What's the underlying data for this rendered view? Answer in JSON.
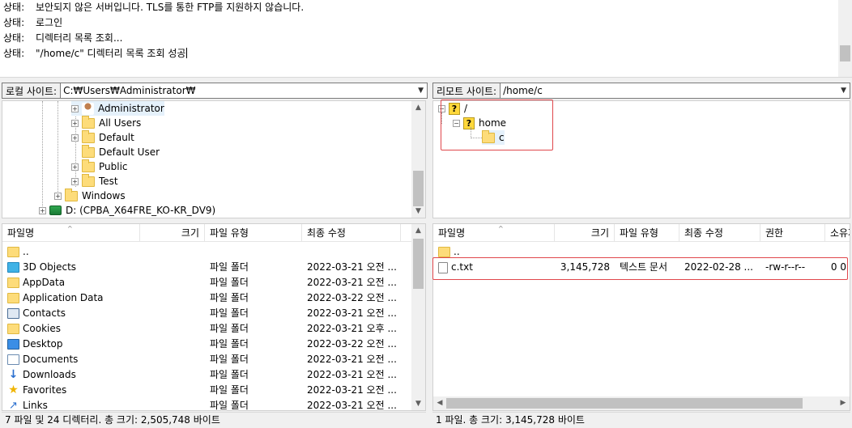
{
  "log": {
    "lines": [
      {
        "key": "상태:",
        "text": "보안되지 않은 서버입니다. TLS를 통한 FTP를 지원하지 않습니다."
      },
      {
        "key": "상태:",
        "text": "로그인"
      },
      {
        "key": "상태:",
        "text": "디렉터리 목록 조회..."
      },
      {
        "key": "상태:",
        "text": "\"/home/c\" 디렉터리 목록 조회 성공"
      }
    ]
  },
  "local": {
    "site_label": "로컬 사이트:",
    "site_path": "C:₩Users₩Administrator₩",
    "tree": [
      {
        "label": "Administrator",
        "icon": "user-icon",
        "expander": "+"
      },
      {
        "label": "All Users",
        "icon": "folder-icon",
        "expander": "+"
      },
      {
        "label": "Default",
        "icon": "folder-icon",
        "expander": "+"
      },
      {
        "label": "Default User",
        "icon": "folder-icon",
        "expander": ""
      },
      {
        "label": "Public",
        "icon": "folder-icon",
        "expander": "+"
      },
      {
        "label": "Test",
        "icon": "folder-icon",
        "expander": "+"
      },
      {
        "label": "Windows",
        "icon": "folder-icon",
        "expander": "+"
      },
      {
        "label": "D: (CPBA_X64FRE_KO-KR_DV9)",
        "icon": "drive-icon",
        "expander": "+"
      }
    ],
    "columns": {
      "name": "파일명",
      "size": "크기",
      "type": "파일 유형",
      "modified": "최종 수정"
    },
    "files": [
      {
        "name": "..",
        "icon": "folder-icon",
        "size": "",
        "type": "",
        "modified": ""
      },
      {
        "name": "3D Objects",
        "icon": "3d-objects-icon",
        "size": "",
        "type": "파일 폴더",
        "modified": "2022-03-21 오전 ..."
      },
      {
        "name": "AppData",
        "icon": "folder-icon",
        "size": "",
        "type": "파일 폴더",
        "modified": "2022-03-21 오전 ..."
      },
      {
        "name": "Application Data",
        "icon": "folder-icon",
        "size": "",
        "type": "파일 폴더",
        "modified": "2022-03-22 오전 ..."
      },
      {
        "name": "Contacts",
        "icon": "contacts-icon",
        "size": "",
        "type": "파일 폴더",
        "modified": "2022-03-21 오전 ..."
      },
      {
        "name": "Cookies",
        "icon": "folder-icon",
        "size": "",
        "type": "파일 폴더",
        "modified": "2022-03-21 오후 ..."
      },
      {
        "name": "Desktop",
        "icon": "desktop-icon",
        "size": "",
        "type": "파일 폴더",
        "modified": "2022-03-22 오전 ..."
      },
      {
        "name": "Documents",
        "icon": "documents-icon",
        "size": "",
        "type": "파일 폴더",
        "modified": "2022-03-21 오전 ..."
      },
      {
        "name": "Downloads",
        "icon": "downloads-icon",
        "size": "",
        "type": "파일 폴더",
        "modified": "2022-03-21 오전 ..."
      },
      {
        "name": "Favorites",
        "icon": "favorites-icon",
        "size": "",
        "type": "파일 폴더",
        "modified": "2022-03-21 오전 ..."
      },
      {
        "name": "Links",
        "icon": "links-icon",
        "size": "",
        "type": "파일 폴더",
        "modified": "2022-03-21 오전 ..."
      }
    ],
    "status": "7 파일 및 24 디렉터리. 총 크기: 2,505,748 바이트"
  },
  "remote": {
    "site_label": "리모트 사이트:",
    "site_path": "/home/c",
    "tree": [
      {
        "label": "/",
        "icon": "unknown-folder-icon",
        "expander": "−"
      },
      {
        "label": "home",
        "icon": "unknown-folder-icon",
        "expander": "−"
      },
      {
        "label": "c",
        "icon": "folder-icon",
        "expander": ""
      }
    ],
    "columns": {
      "name": "파일명",
      "size": "크기",
      "type": "파일 유형",
      "modified": "최종 수정",
      "perms": "권한",
      "owner": "소유자"
    },
    "files": [
      {
        "name": "..",
        "icon": "folder-icon",
        "size": "",
        "type": "",
        "modified": "",
        "perms": "",
        "owner": ""
      },
      {
        "name": "c.txt",
        "icon": "text-file-icon",
        "size": "3,145,728",
        "type": "텍스트 문서",
        "modified": "2022-02-28 ...",
        "perms": "-rw-r--r--",
        "owner": "0 0"
      }
    ],
    "status": "1 파일. 총 크기: 3,145,728 바이트"
  },
  "colors": {
    "highlight": "#e0474c",
    "selection": "#e5f1fb"
  }
}
